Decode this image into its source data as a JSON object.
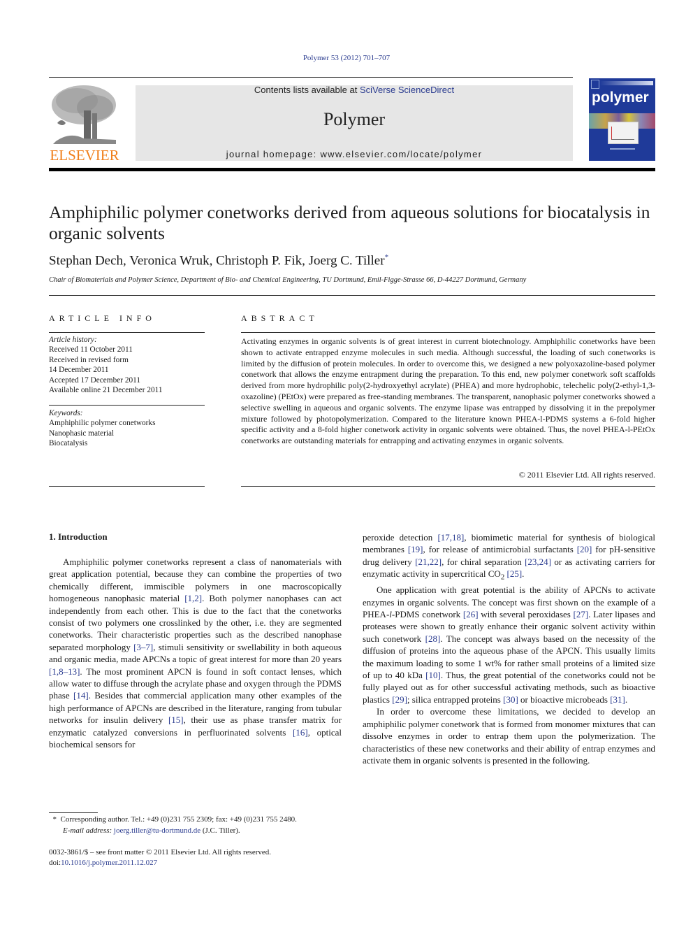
{
  "header": {
    "citation": "Polymer 53 (2012) 701–707",
    "contents_prefix": "Contents lists available at ",
    "contents_link": "SciVerse ScienceDirect",
    "journal_name": "Polymer",
    "homepage_label": "journal homepage: www.elsevier.com/locate/polymer",
    "publisher_logo_text": "ELSEVIER",
    "cover_title": "polymer"
  },
  "article": {
    "title": "Amphiphilic polymer conetworks derived from aqueous solutions for biocatalysis in organic solvents",
    "authors": "Stephan Dech, Veronica Wruk, Christoph P. Fik, Joerg C. Tiller",
    "corresponding_mark": "*",
    "affiliation": "Chair of Biomaterials and Polymer Science, Department of Bio- and Chemical Engineering, TU Dortmund, Emil-Figge-Strasse 66, D-44227 Dortmund, Germany"
  },
  "article_info": {
    "heading": "ARTICLE INFO",
    "history_label": "Article history:",
    "history": [
      "Received 11 October 2011",
      "Received in revised form",
      "14 December 2011",
      "Accepted 17 December 2011",
      "Available online 21 December 2011"
    ],
    "keywords_label": "Keywords:",
    "keywords": [
      "Amphiphilic polymer conetworks",
      "Nanophasic material",
      "Biocatalysis"
    ]
  },
  "abstract": {
    "heading": "ABSTRACT",
    "text": "Activating enzymes in organic solvents is of great interest in current biotechnology. Amphiphilic conetworks have been shown to activate entrapped enzyme molecules in such media. Although successful, the loading of such conetworks is limited by the diffusion of protein molecules. In order to overcome this, we designed a new polyoxazoline-based polymer conetwork that allows the enzyme entrapment during the preparation. To this end, new polymer conetwork soft scaffolds derived from more hydrophilic poly(2-hydroxyethyl acrylate) (PHEA) and more hydrophobic, telechelic poly(2-ethyl-1,3-oxazoline) (PEtOx) were prepared as free-standing membranes. The transparent, nanophasic polymer conetworks showed a selective swelling in aqueous and organic solvents. The enzyme lipase was entrapped by dissolving it in the prepolymer mixture followed by photopolymerization. Compared to the literature known PHEA-l-PDMS systems a 6-fold higher specific activity and a 8-fold higher conetwork activity in organic solvents were obtained. Thus, the novel PHEA-l-PEtOx conetworks are outstanding materials for entrapping and activating enzymes in organic solvents.",
    "copyright": "© 2011 Elsevier Ltd. All rights reserved."
  },
  "introduction": {
    "heading": "1.  Introduction",
    "left_paragraph": [
      {
        "t": "Amphiphilic polymer conetworks represent a class of nanomaterials with great application potential, because they can combine the properties of two chemically different, immiscible polymers in one macroscopically homogeneous nanophasic material "
      },
      {
        "ref": "[1,2]"
      },
      {
        "t": ". Both polymer nanophases can act independently from each other. This is due to the fact that the conetworks consist of two polymers one crosslinked by the other, i.e. they are segmented conetworks. Their characteristic properties such as the described nanophase separated morphology "
      },
      {
        "ref": "[3–7]"
      },
      {
        "t": ", stimuli sensitivity or swellability in both aqueous and organic media, made APCNs a topic of great interest for more than 20 years "
      },
      {
        "ref": "[1,8–13]"
      },
      {
        "t": ". The most prominent APCN is found in soft contact lenses, which allow water to diffuse through the acrylate phase and oxygen through the PDMS phase "
      },
      {
        "ref": "[14]"
      },
      {
        "t": ". Besides that commercial application many other examples of the high performance of APCNs are described in the literature, ranging from tubular networks for insulin delivery "
      },
      {
        "ref": "[15]"
      },
      {
        "t": ", their use as phase transfer matrix for enzymatic catalyzed conversions in perfluorinated solvents "
      },
      {
        "ref": "[16]"
      },
      {
        "t": ", optical biochemical sensors for"
      }
    ],
    "right_paragraph_1": [
      {
        "t": "peroxide detection "
      },
      {
        "ref": "[17,18]"
      },
      {
        "t": ", biomimetic material for synthesis of biological membranes "
      },
      {
        "ref": "[19]"
      },
      {
        "t": ", for release of antimicrobial surfactants "
      },
      {
        "ref": "[20]"
      },
      {
        "t": " for pH-sensitive drug delivery "
      },
      {
        "ref": "[21,22]"
      },
      {
        "t": ", for chiral separation "
      },
      {
        "ref": "[23,24]"
      },
      {
        "t": " or as activating carriers for enzymatic activity in supercritical CO"
      },
      {
        "sub": "2"
      },
      {
        "t": " "
      },
      {
        "ref": "[25]"
      },
      {
        "t": "."
      }
    ],
    "right_paragraph_2": [
      {
        "t": "One application with great potential is the ability of APCNs to activate enzymes in organic solvents. The concept was first shown on the example of a PHEA-"
      },
      {
        "i": "l"
      },
      {
        "t": "-PDMS conetwork "
      },
      {
        "ref": "[26]"
      },
      {
        "t": " with several peroxidases "
      },
      {
        "ref": "[27]"
      },
      {
        "t": ". Later lipases and proteases were shown to greatly enhance their organic solvent activity within such conetwork "
      },
      {
        "ref": "[28]"
      },
      {
        "t": ". The concept was always based on the necessity of the diffusion of proteins into the aqueous phase of the APCN. This usually limits the maximum loading to some 1 wt% for rather small proteins of a limited size of up to 40 kDa "
      },
      {
        "ref": "[10]"
      },
      {
        "t": ". Thus, the great potential of the conetworks could not be fully played out as for other successful activating methods, such as bioactive plastics "
      },
      {
        "ref": "[29]"
      },
      {
        "t": "; silica entrapped proteins "
      },
      {
        "ref": "[30]"
      },
      {
        "t": " or bioactive microbeads "
      },
      {
        "ref": "[31]"
      },
      {
        "t": "."
      }
    ],
    "right_paragraph_3": [
      {
        "t": "In order to overcome these limitations, we decided to develop an amphiphilic polymer conetwork that is formed from monomer mixtures that can dissolve enzymes in order to entrap them upon the polymerization. The characteristics of these new conetworks and their ability of entrap enzymes and activate them in organic solvents is presented in the following."
      }
    ]
  },
  "footnote": {
    "mark": "*",
    "corresponding": "Corresponding author. Tel.: +49 (0)231 755 2309; fax: +49 (0)231 755 2480.",
    "email_label": "E-mail address:",
    "email": "joerg.tiller@tu-dortmund.de",
    "email_suffix": "(J.C. Tiller)."
  },
  "front_matter": {
    "issn_line": "0032-3861/$ – see front matter © 2011 Elsevier Ltd. All rights reserved.",
    "doi_label": "doi:",
    "doi": "10.1016/j.polymer.2011.12.027"
  }
}
